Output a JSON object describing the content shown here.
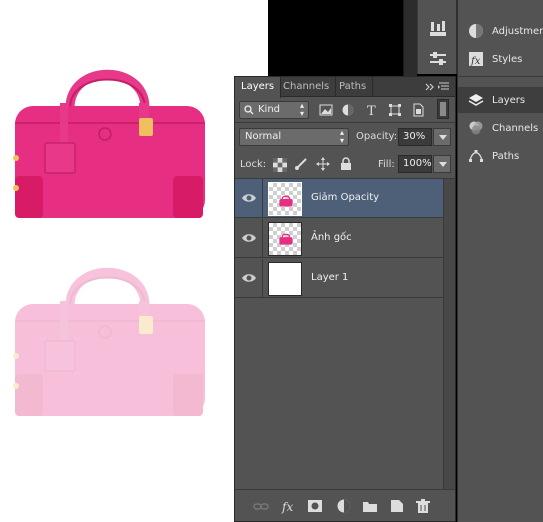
{
  "dock": {
    "items": [
      {
        "label": "Adjustments",
        "icon": "adjustments-icon"
      },
      {
        "label": "Styles",
        "icon": "styles-icon"
      },
      {
        "label": "Layers",
        "icon": "layers-icon",
        "active": true
      },
      {
        "label": "Channels",
        "icon": "channels-icon"
      },
      {
        "label": "Paths",
        "icon": "paths-icon"
      }
    ]
  },
  "panel": {
    "tabs": [
      "Layers",
      "Channels",
      "Paths"
    ],
    "filter": {
      "kind": "Kind"
    },
    "blend_mode": "Normal",
    "opacity_label": "Opacity:",
    "opacity_value": "30%",
    "lock_label": "Lock:",
    "fill_label": "Fill:",
    "fill_value": "100%",
    "layers": [
      {
        "name": "Giảm Opacity",
        "selected": true,
        "thumb": "checker-bag"
      },
      {
        "name": "Ảnh gốc",
        "selected": false,
        "thumb": "checker-bag"
      },
      {
        "name": "Layer 1",
        "selected": false,
        "thumb": "white"
      }
    ],
    "bottom_icons": [
      "link-icon",
      "fx-icon",
      "mask-icon",
      "adjustment-layer-icon",
      "folder-icon",
      "new-layer-icon",
      "trash-icon"
    ]
  },
  "colors": {
    "bag": "#e62e83",
    "bag_dark": "#c41e66",
    "panel_bg": "#535353",
    "selection": "#4e5f78"
  },
  "canvas": {
    "top_bag_opacity": 1.0,
    "bottom_bag_opacity": 0.3
  }
}
